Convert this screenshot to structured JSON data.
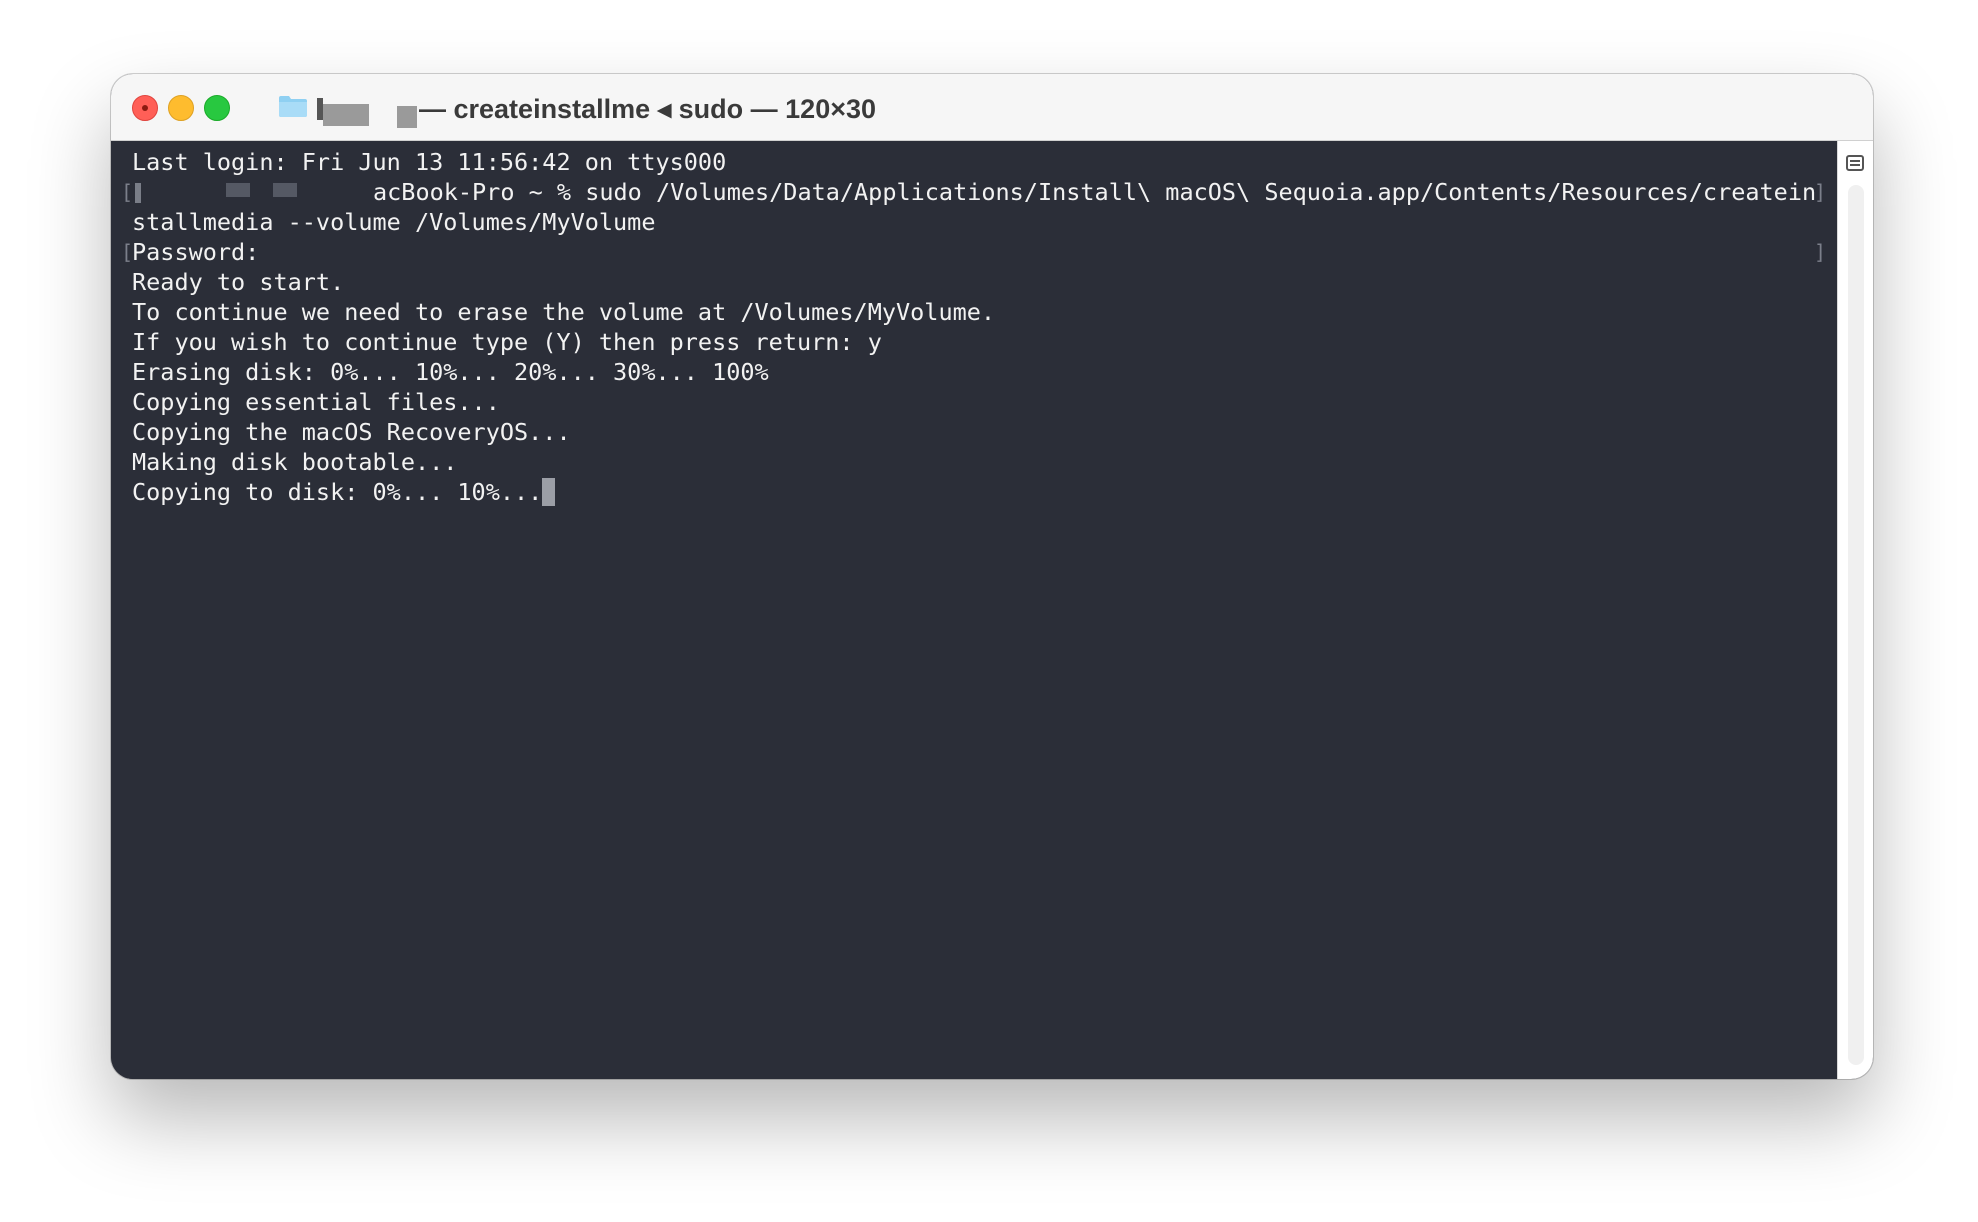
{
  "window": {
    "title": "— createinstallme ◂ sudo — 120×30"
  },
  "icons": {
    "close": "close-button",
    "minimize": "minimize-button",
    "zoom": "zoom-button",
    "folder": "folder-icon",
    "split": "split-view-icon"
  },
  "colors": {
    "terminal_bg": "#2b2e38",
    "terminal_fg": "#f2f2f2",
    "close": "#ff5f57",
    "minimize": "#febc2e",
    "zoom": "#28c840"
  },
  "terminal": {
    "lines": [
      "Last login: Fri Jun 13 11:56:42 on ttys000",
      "acBook-Pro ~ % sudo /Volumes/Data/Applications/Install\\ macOS\\ Sequoia.app/Contents/Resources/createin",
      "stallmedia --volume /Volumes/MyVolume",
      "Password:",
      "Ready to start.",
      "To continue we need to erase the volume at /Volumes/MyVolume.",
      "If you wish to continue type (Y) then press return: y",
      "Erasing disk: 0%... 10%... 20%... 30%... 100%",
      "Copying essential files...",
      "Copying the macOS RecoveryOS...",
      "Making disk bootable...",
      "Copying to disk: 0%... 10%..."
    ]
  }
}
